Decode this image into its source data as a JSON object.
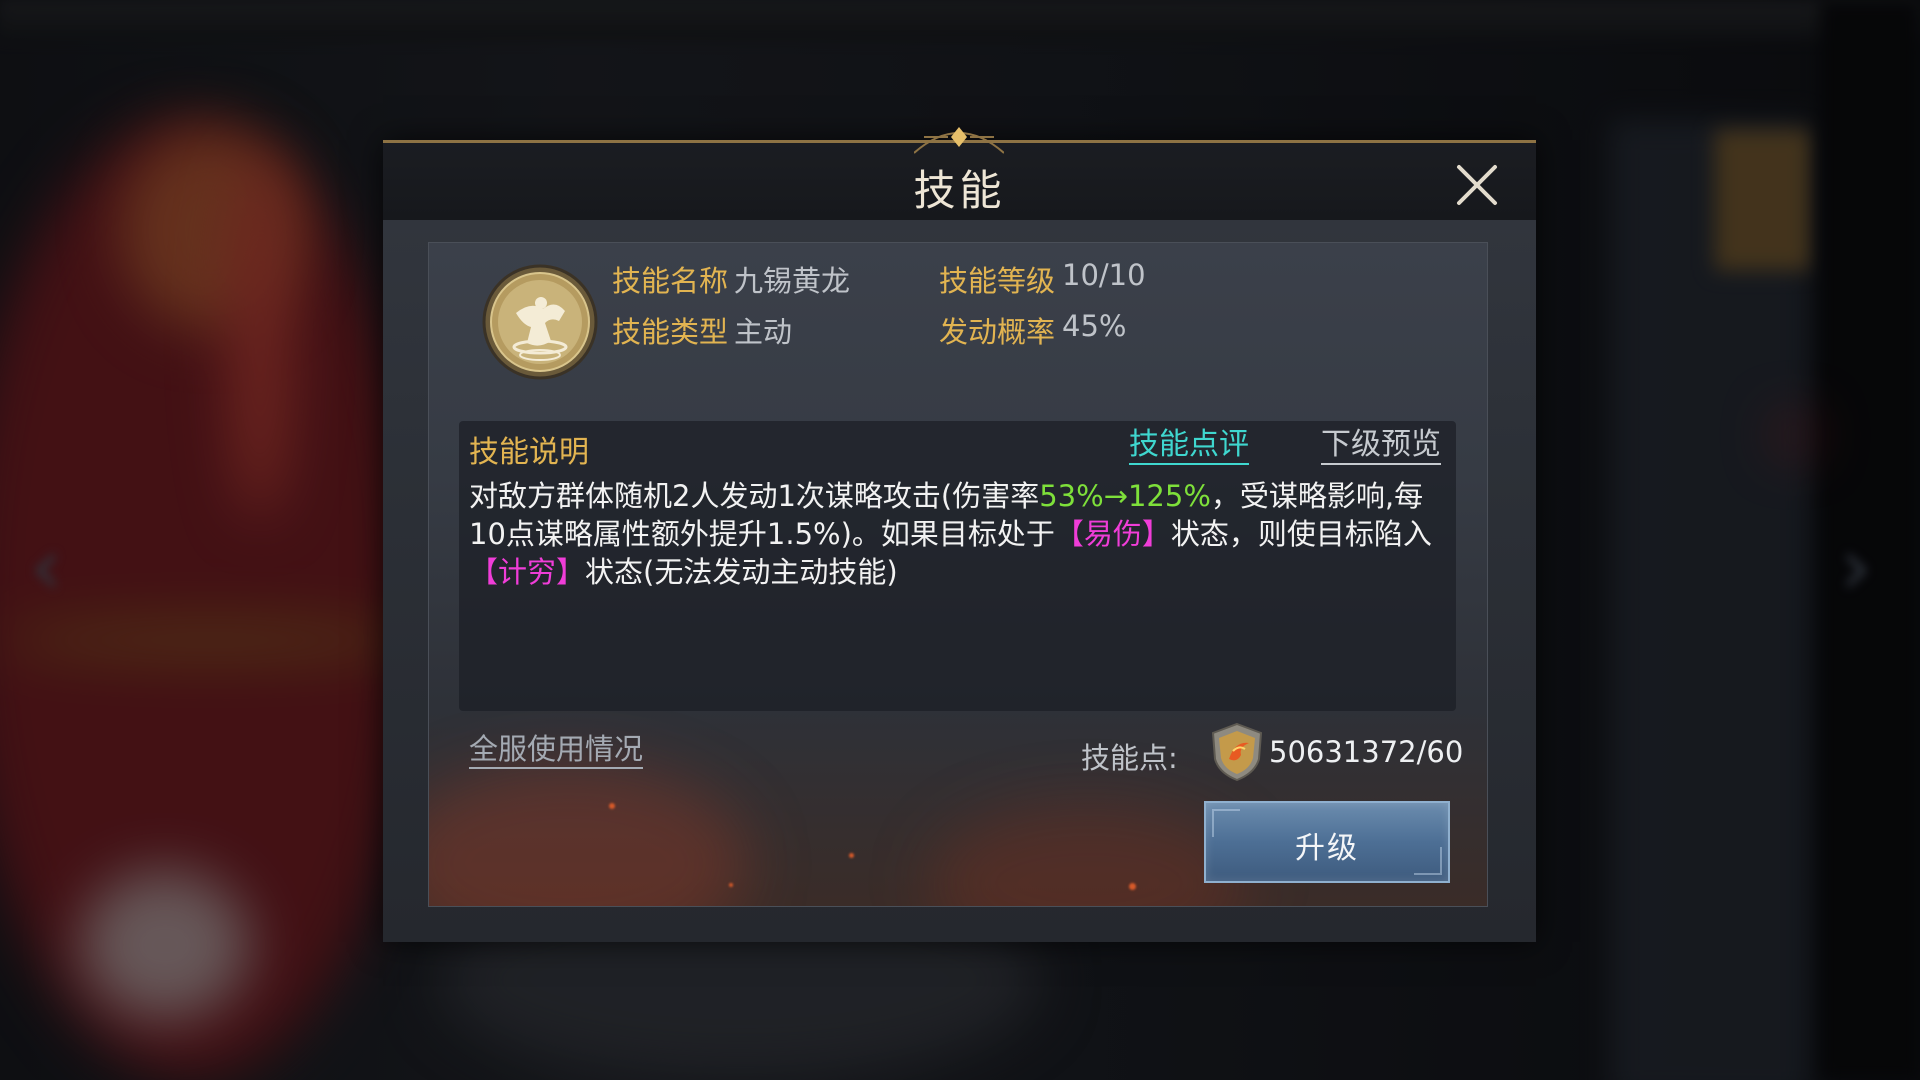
{
  "dialog": {
    "title": "技能",
    "close_icon": "close-icon"
  },
  "skill": {
    "icon": "skill-emblem-icon",
    "name_label": "技能名称",
    "name_value": "九锡黄龙",
    "level_label": "技能等级",
    "level_value": "10/10",
    "type_label": "技能类型",
    "type_value": "主动",
    "rate_label": "发动概率",
    "rate_value": "45%"
  },
  "description": {
    "title": "技能说明",
    "review_link": "技能点评",
    "preview_link": "下级预览",
    "parts": {
      "p1": "对敌方群体随机2人发动1次谋略攻击(伤害率",
      "p2": "53%→125%",
      "p3": "，受谋略影响,每10点谋略属性额外提升1.5%)。如果目标处于",
      "p4": "【易伤】",
      "p5": "状态，则使目标陷入",
      "p6": "【计穷】",
      "p7": "状态(无法发动主动技能)"
    }
  },
  "footer": {
    "usage_link": "全服使用情况",
    "points_label": "技能点:",
    "points_icon": "shield-medal-icon",
    "points_value": "50631372/60",
    "upgrade_button": "升级"
  },
  "colors": {
    "accent_gold": "#e2b451",
    "link_cyan": "#3fd7cf",
    "highlight_green": "#7ee03a",
    "highlight_pink": "#f03dd8",
    "button_blue": "#4d6f95"
  }
}
